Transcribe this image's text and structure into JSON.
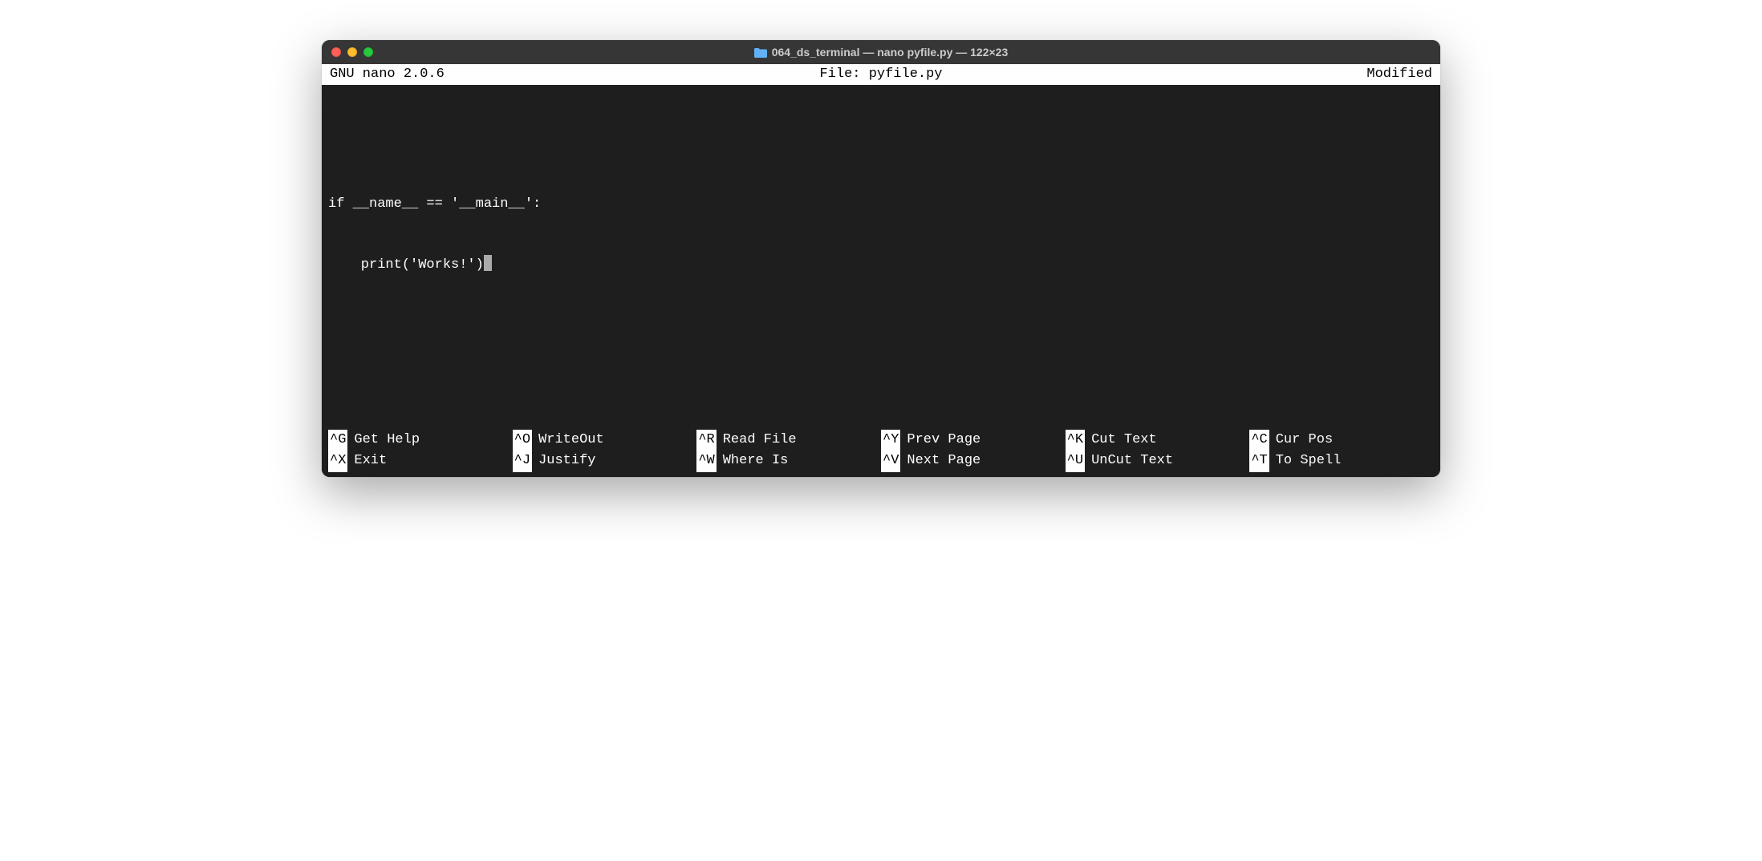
{
  "window": {
    "title": "064_ds_terminal — nano pyfile.py — 122×23"
  },
  "nano": {
    "version_label": "GNU nano 2.0.6",
    "file_label": "File: pyfile.py",
    "status_label": "Modified"
  },
  "content": {
    "line1": "if __name__ == '__main__':",
    "line2": "    print('Works!')"
  },
  "shortcuts": {
    "row1": [
      {
        "key": "^G",
        "label": "Get Help"
      },
      {
        "key": "^O",
        "label": "WriteOut"
      },
      {
        "key": "^R",
        "label": "Read File"
      },
      {
        "key": "^Y",
        "label": "Prev Page"
      },
      {
        "key": "^K",
        "label": "Cut Text"
      },
      {
        "key": "^C",
        "label": "Cur Pos"
      }
    ],
    "row2": [
      {
        "key": "^X",
        "label": "Exit"
      },
      {
        "key": "^J",
        "label": "Justify"
      },
      {
        "key": "^W",
        "label": "Where Is"
      },
      {
        "key": "^V",
        "label": "Next Page"
      },
      {
        "key": "^U",
        "label": "UnCut Text"
      },
      {
        "key": "^T",
        "label": "To Spell"
      }
    ]
  }
}
